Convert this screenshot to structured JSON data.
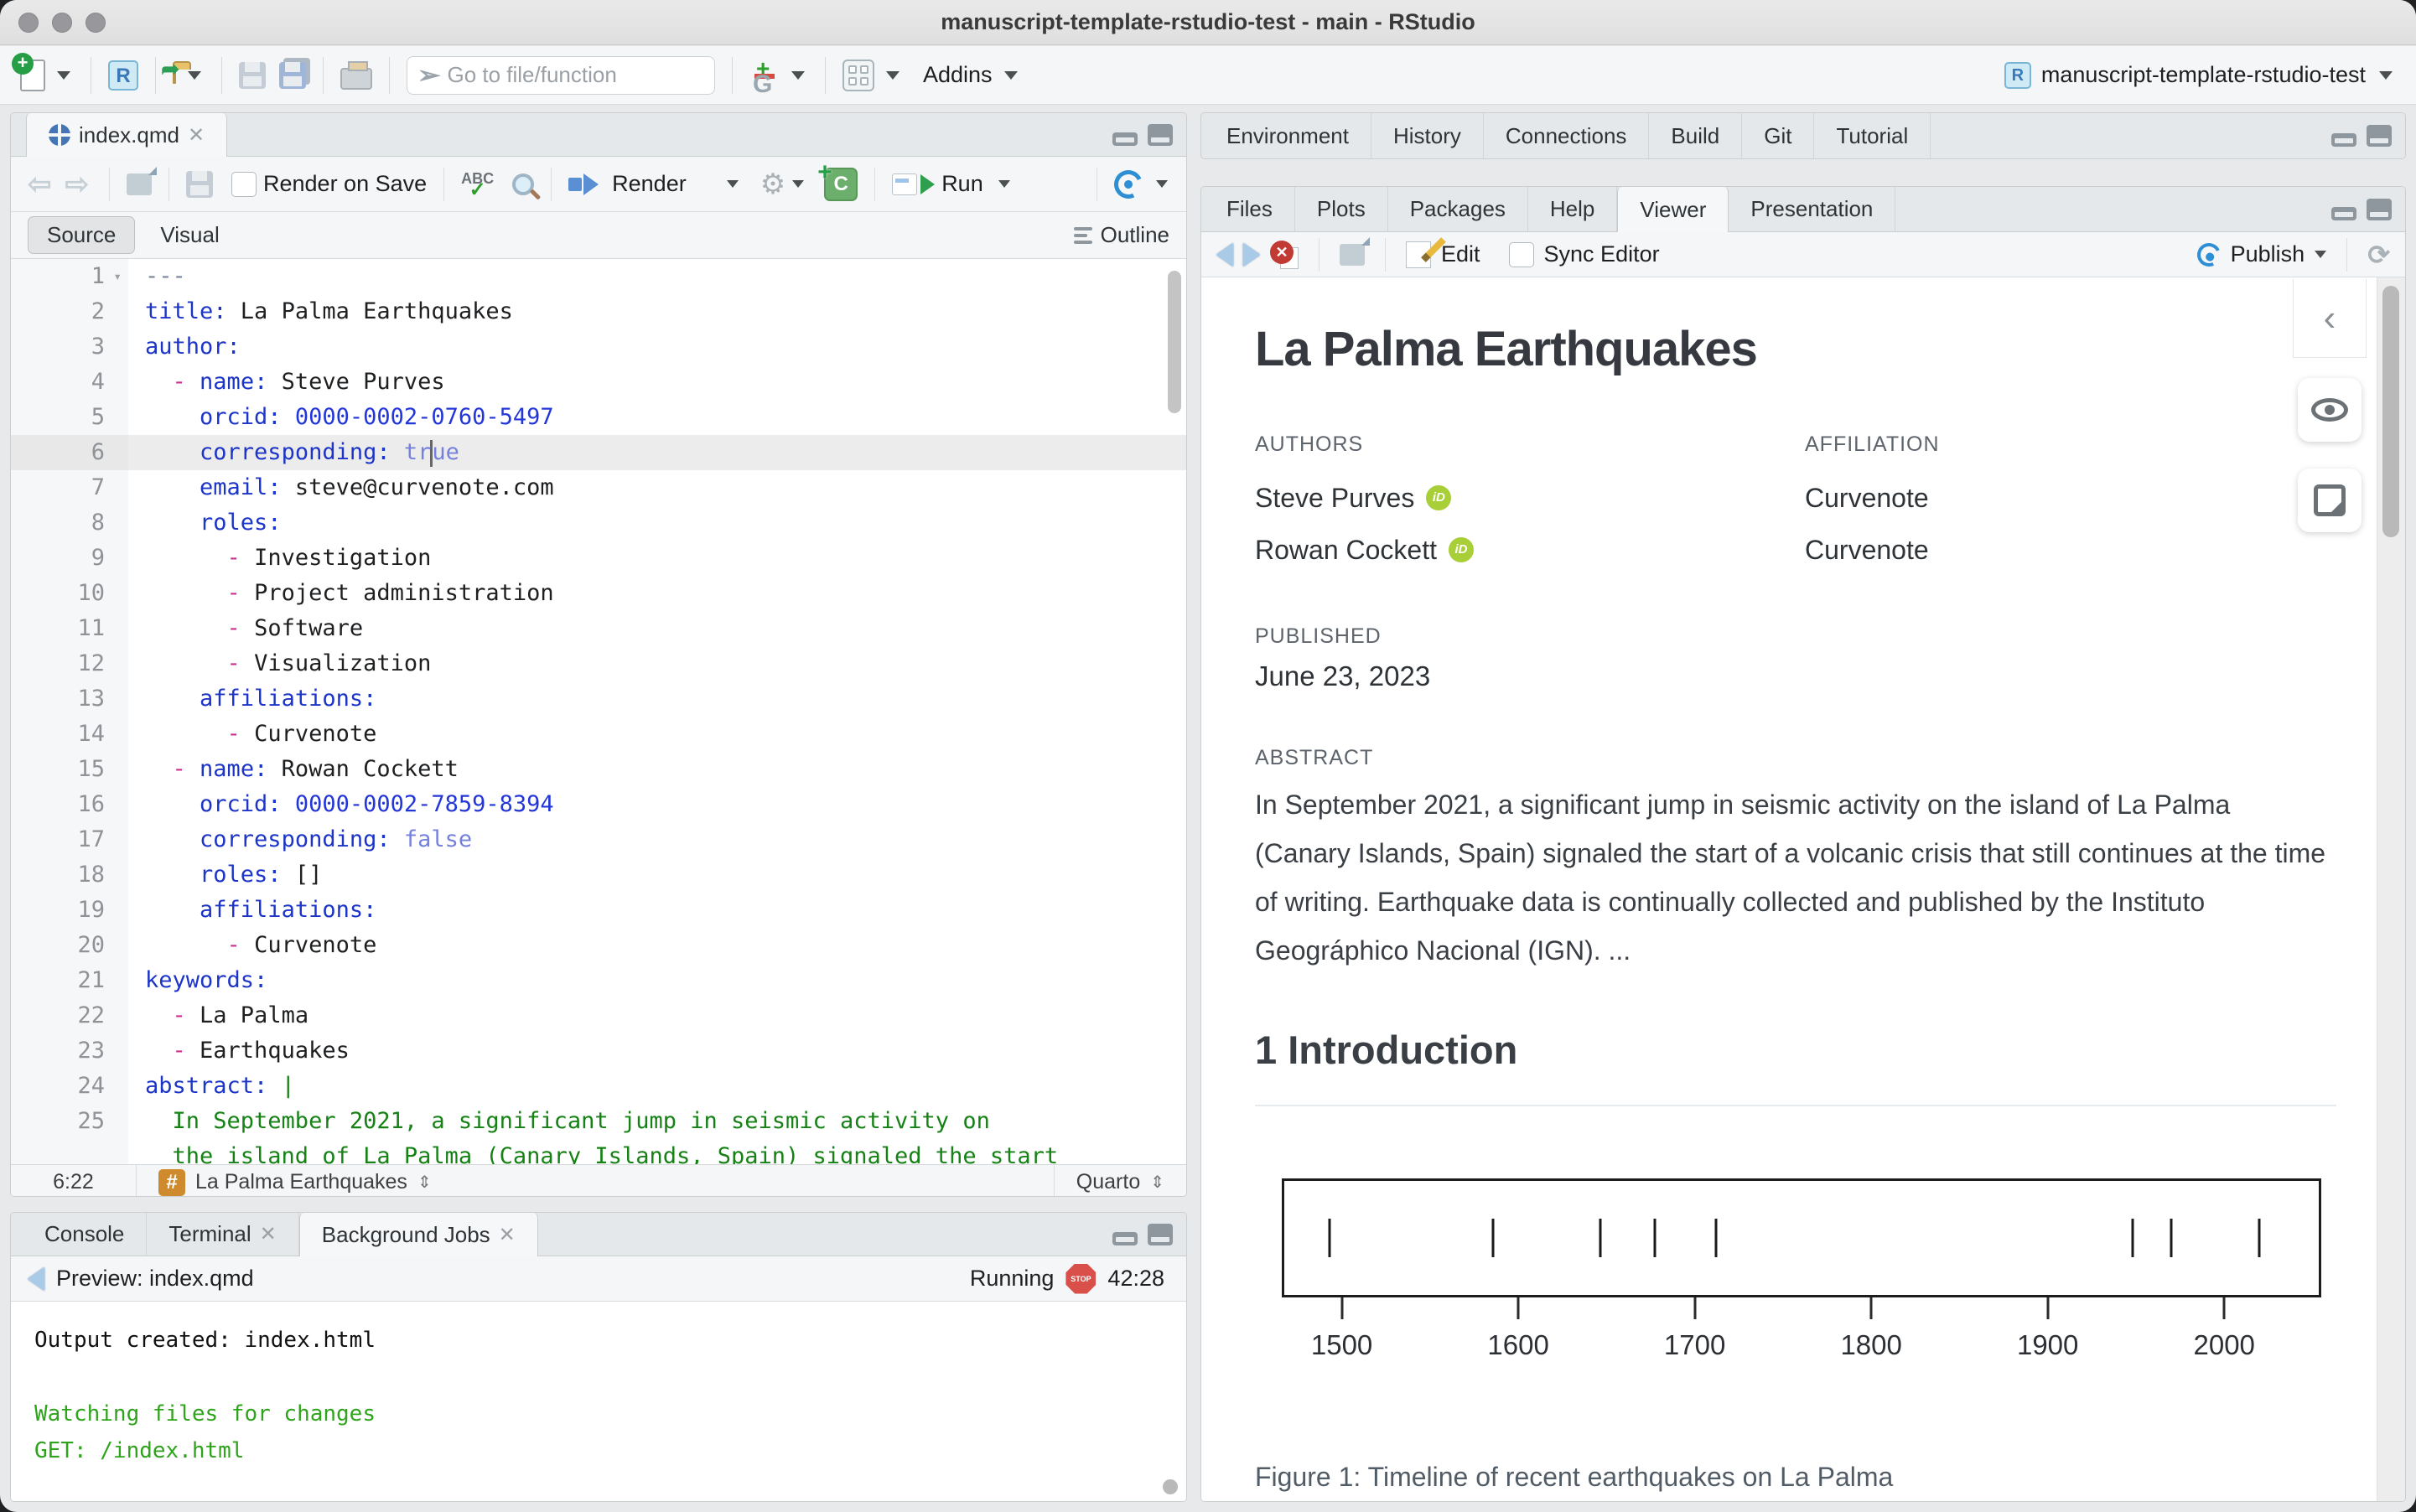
{
  "window": {
    "title": "manuscript-template-rstudio-test - main - RStudio"
  },
  "main_toolbar": {
    "goto_placeholder": "Go to file/function",
    "addins_label": "Addins",
    "project_label": "manuscript-template-rstudio-test"
  },
  "editor": {
    "tab_label": "index.qmd",
    "render_on_save_label": "Render on Save",
    "render_label": "Render",
    "run_label": "Run",
    "source_label": "Source",
    "visual_label": "Visual",
    "outline_label": "Outline",
    "status": {
      "position": "6:22",
      "symbol": "La Palma Earthquakes",
      "mode": "Quarto"
    },
    "code_lines": [
      {
        "n": "1",
        "fold": true,
        "segs": [
          {
            "t": "---",
            "c": "sm"
          }
        ]
      },
      {
        "n": "2",
        "segs": [
          {
            "t": "title:",
            "c": "sk"
          },
          {
            "t": " La Palma Earthquakes",
            "c": ""
          }
        ]
      },
      {
        "n": "3",
        "segs": [
          {
            "t": "author:",
            "c": "sk"
          }
        ]
      },
      {
        "n": "4",
        "segs": [
          {
            "t": "  ",
            "c": ""
          },
          {
            "t": "-",
            "c": "sd"
          },
          {
            "t": " ",
            "c": ""
          },
          {
            "t": "name:",
            "c": "sk"
          },
          {
            "t": " Steve Purves",
            "c": ""
          }
        ]
      },
      {
        "n": "5",
        "segs": [
          {
            "t": "    ",
            "c": ""
          },
          {
            "t": "orcid:",
            "c": "sk"
          },
          {
            "t": " 0000-0002-0760-5497",
            "c": "sn"
          }
        ]
      },
      {
        "n": "6",
        "active": true,
        "segs": [
          {
            "t": "    ",
            "c": ""
          },
          {
            "t": "corresponding:",
            "c": "sk"
          },
          {
            "t": " tr",
            "c": "sb"
          },
          {
            "t": "",
            "c": "cursor"
          },
          {
            "t": "ue",
            "c": "sb"
          }
        ]
      },
      {
        "n": "7",
        "segs": [
          {
            "t": "    ",
            "c": ""
          },
          {
            "t": "email:",
            "c": "sk"
          },
          {
            "t": " steve@curvenote.com",
            "c": ""
          }
        ]
      },
      {
        "n": "8",
        "segs": [
          {
            "t": "    ",
            "c": ""
          },
          {
            "t": "roles:",
            "c": "sk"
          }
        ]
      },
      {
        "n": "9",
        "segs": [
          {
            "t": "      ",
            "c": ""
          },
          {
            "t": "-",
            "c": "sd"
          },
          {
            "t": " Investigation",
            "c": ""
          }
        ]
      },
      {
        "n": "10",
        "segs": [
          {
            "t": "      ",
            "c": ""
          },
          {
            "t": "-",
            "c": "sd"
          },
          {
            "t": " Project administration",
            "c": ""
          }
        ]
      },
      {
        "n": "11",
        "segs": [
          {
            "t": "      ",
            "c": ""
          },
          {
            "t": "-",
            "c": "sd"
          },
          {
            "t": " Software",
            "c": ""
          }
        ]
      },
      {
        "n": "12",
        "segs": [
          {
            "t": "      ",
            "c": ""
          },
          {
            "t": "-",
            "c": "sd"
          },
          {
            "t": " Visualization",
            "c": ""
          }
        ]
      },
      {
        "n": "13",
        "segs": [
          {
            "t": "    ",
            "c": ""
          },
          {
            "t": "affiliations:",
            "c": "sk"
          }
        ]
      },
      {
        "n": "14",
        "segs": [
          {
            "t": "      ",
            "c": ""
          },
          {
            "t": "-",
            "c": "sd"
          },
          {
            "t": " Curvenote",
            "c": ""
          }
        ]
      },
      {
        "n": "15",
        "segs": [
          {
            "t": "  ",
            "c": ""
          },
          {
            "t": "-",
            "c": "sd"
          },
          {
            "t": " ",
            "c": ""
          },
          {
            "t": "name:",
            "c": "sk"
          },
          {
            "t": " Rowan Cockett",
            "c": ""
          }
        ]
      },
      {
        "n": "16",
        "segs": [
          {
            "t": "    ",
            "c": ""
          },
          {
            "t": "orcid:",
            "c": "sk"
          },
          {
            "t": " 0000-0002-7859-8394",
            "c": "sn"
          }
        ]
      },
      {
        "n": "17",
        "segs": [
          {
            "t": "    ",
            "c": ""
          },
          {
            "t": "corresponding:",
            "c": "sk"
          },
          {
            "t": " false",
            "c": "sb"
          }
        ]
      },
      {
        "n": "18",
        "segs": [
          {
            "t": "    ",
            "c": ""
          },
          {
            "t": "roles:",
            "c": "sk"
          },
          {
            "t": " []",
            "c": ""
          }
        ]
      },
      {
        "n": "19",
        "segs": [
          {
            "t": "    ",
            "c": ""
          },
          {
            "t": "affiliations:",
            "c": "sk"
          }
        ]
      },
      {
        "n": "20",
        "segs": [
          {
            "t": "      ",
            "c": ""
          },
          {
            "t": "-",
            "c": "sd"
          },
          {
            "t": " Curvenote",
            "c": ""
          }
        ]
      },
      {
        "n": "21",
        "segs": [
          {
            "t": "keywords:",
            "c": "sk"
          }
        ]
      },
      {
        "n": "22",
        "segs": [
          {
            "t": "  ",
            "c": ""
          },
          {
            "t": "-",
            "c": "sd"
          },
          {
            "t": " La Palma",
            "c": ""
          }
        ]
      },
      {
        "n": "23",
        "segs": [
          {
            "t": "  ",
            "c": ""
          },
          {
            "t": "-",
            "c": "sd"
          },
          {
            "t": " Earthquakes",
            "c": ""
          }
        ]
      },
      {
        "n": "24",
        "segs": [
          {
            "t": "abstract:",
            "c": "sk"
          },
          {
            "t": " |",
            "c": "ss"
          }
        ]
      },
      {
        "n": "25",
        "segs": [
          {
            "t": "  In September 2021, a significant jump in seismic activity on",
            "c": "ss"
          }
        ]
      },
      {
        "n": "",
        "segs": [
          {
            "t": "  the island of La Palma (Canary Islands, Spain) signaled the start",
            "c": "ss"
          }
        ]
      }
    ]
  },
  "console": {
    "tabs": [
      {
        "label": "Console",
        "close": false,
        "active": false
      },
      {
        "label": "Terminal",
        "close": true,
        "active": false
      },
      {
        "label": "Background Jobs",
        "close": true,
        "active": true
      }
    ],
    "preview_label": "Preview: index.qmd",
    "running_label": "Running",
    "stop_label": "STOP",
    "elapsed": "42:28",
    "output": [
      {
        "text": "Output created: index.html",
        "color": "default"
      },
      {
        "text": "",
        "color": "default"
      },
      {
        "text": "Watching files for changes",
        "color": "green"
      },
      {
        "text": "GET: /index.html",
        "color": "green"
      }
    ]
  },
  "right_top_tabs": [
    "Environment",
    "History",
    "Connections",
    "Build",
    "Git",
    "Tutorial"
  ],
  "files_pane": {
    "tabs": [
      "Files",
      "Plots",
      "Packages",
      "Help",
      "Viewer",
      "Presentation"
    ],
    "active_tab": "Viewer",
    "edit_label": "Edit",
    "sync_editor_label": "Sync Editor",
    "publish_label": "Publish"
  },
  "viewer_doc": {
    "title": "La Palma Earthquakes",
    "authors_label": "AUTHORS",
    "affiliation_label": "AFFILIATION",
    "authors": [
      {
        "name": "Steve Purves",
        "affiliation": "Curvenote"
      },
      {
        "name": "Rowan Cockett",
        "affiliation": "Curvenote"
      }
    ],
    "published_label": "PUBLISHED",
    "published_date": "June 23, 2023",
    "abstract_label": "ABSTRACT",
    "abstract_text": "In September 2021, a significant jump in seismic activity on the island of La Palma (Canary Islands, Spain) signaled the start of a volcanic crisis that still continues at the time of writing. Earthquake data is continually collected and published by the Instituto Geográphico Nacional (IGN). ...",
    "section_heading": "1 Introduction",
    "figure_caption": "Figure 1: Timeline of recent earthquakes on La Palma"
  },
  "chart_data": {
    "type": "scatter",
    "subtype": "rug-timeline",
    "title": "Figure 1: Timeline of recent earthquakes on La Palma",
    "x": [
      1492,
      1585,
      1646,
      1677,
      1712,
      1949,
      1971,
      2021
    ],
    "xlabel": "",
    "ylabel": "",
    "xticks": [
      1500,
      1600,
      1700,
      1800,
      1900,
      2000
    ],
    "xlim": [
      1466,
      2055
    ],
    "grid": false,
    "legend": "none"
  },
  "colors": {
    "accent_blue": "#2e8fd4",
    "run_green": "#2f9e4e",
    "console_green": "#2fa31c",
    "orcid_green": "#a8ce38",
    "hash_badge_orange": "#cf8a2d",
    "stop_red": "#d94f4a"
  }
}
